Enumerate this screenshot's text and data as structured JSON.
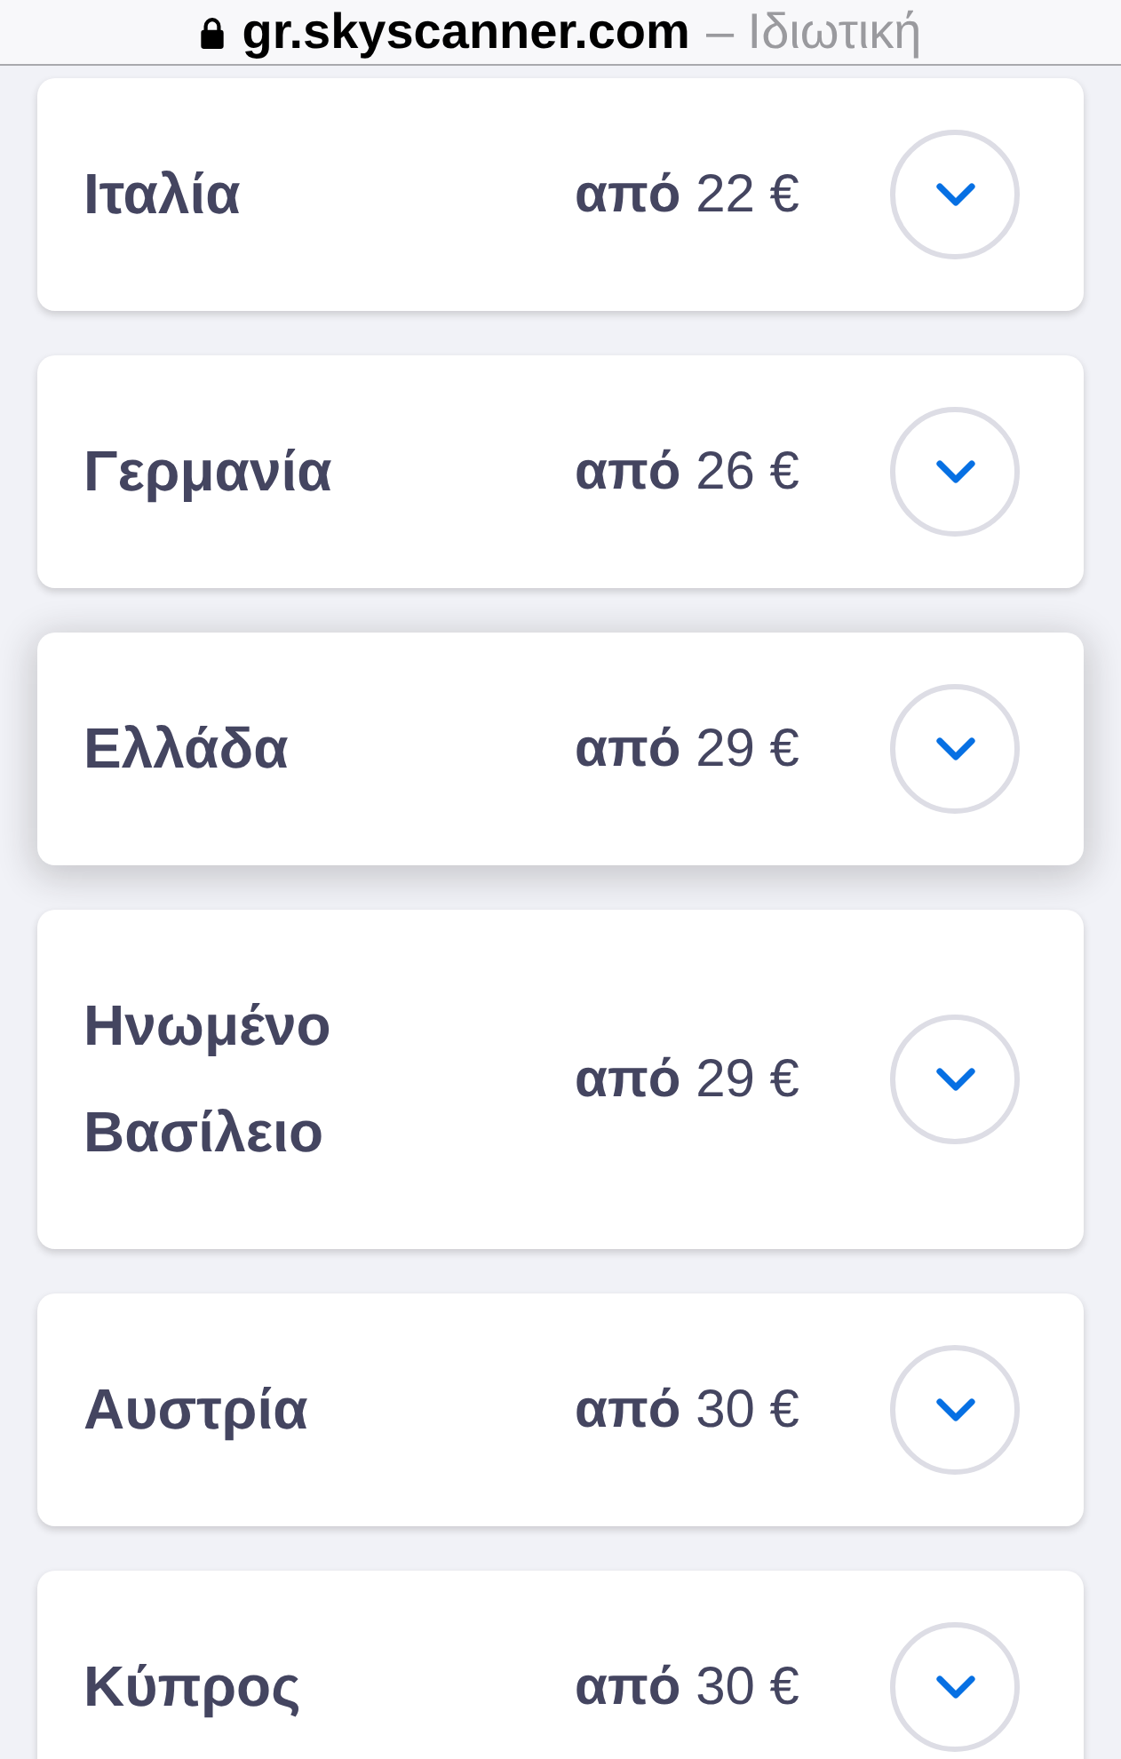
{
  "address_bar": {
    "secure": true,
    "url": "gr.skyscanner.com",
    "mode_label": "– Ιδιωτική"
  },
  "destinations": [
    {
      "name": "Ιταλία",
      "price": "**από** 22 €",
      "expanded": false,
      "elevated": false
    },
    {
      "name": "Γερμανία",
      "price": "**από** 26 €",
      "expanded": false,
      "elevated": false
    },
    {
      "name": "Ελλάδα",
      "price": "**από** 29 €",
      "expanded": false,
      "elevated": true
    },
    {
      "name": "Ηνωμένο Βασίλειο",
      "price": "**από** 29 €",
      "expanded": false,
      "elevated": false
    },
    {
      "name": "Αυστρία",
      "price": "**από** 30 €",
      "expanded": false,
      "elevated": false
    },
    {
      "name": "Κύπρος",
      "price": "**από** 30 €",
      "expanded": false,
      "elevated": false
    }
  ]
}
